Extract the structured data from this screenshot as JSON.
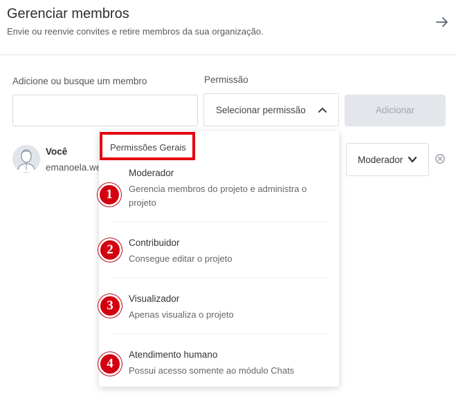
{
  "header": {
    "title": "Gerenciar membros",
    "subtitle": "Envie ou reenvie convites e retire membros da sua organização."
  },
  "form": {
    "member_label": "Adicione ou busque um membro",
    "member_value": "",
    "permission_label": "Permissão",
    "permission_select": "Selecionar permissão",
    "add_button": "Adicionar"
  },
  "member": {
    "name": "Você",
    "email": "emanoela.we",
    "role": "Moderador"
  },
  "dropdown": {
    "group_label": "Permissões Gerais",
    "options": [
      {
        "badge": "1",
        "title": "Moderador",
        "desc": "Gerencia membros do projeto e administra o projeto"
      },
      {
        "badge": "2",
        "title": "Contribuidor",
        "desc": "Consegue editar o projeto"
      },
      {
        "badge": "3",
        "title": "Visualizador",
        "desc": "Apenas visualiza o projeto"
      },
      {
        "badge": "4",
        "title": "Atendimento humano",
        "desc": "Possui acesso somente ao módulo Chats"
      }
    ]
  },
  "colors": {
    "annotation_red": "#d40010",
    "disabled_button_bg": "#e3e6ea"
  },
  "icons": [
    "arrow-right-icon",
    "chevron-up-icon",
    "chevron-down-icon",
    "remove-circle-icon",
    "user-avatar-icon"
  ]
}
